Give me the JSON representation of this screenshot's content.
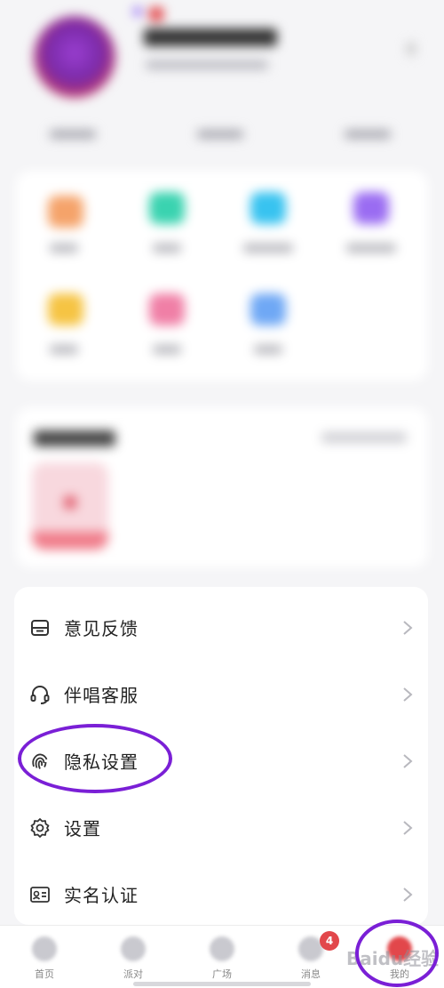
{
  "menu": {
    "items": [
      {
        "label": "意见反馈",
        "icon": "feedback-icon"
      },
      {
        "label": "伴唱客服",
        "icon": "headset-icon"
      },
      {
        "label": "隐私设置",
        "icon": "fingerprint-icon"
      },
      {
        "label": "设置",
        "icon": "gear-icon"
      },
      {
        "label": "实名认证",
        "icon": "id-card-icon"
      }
    ]
  },
  "tabbar": {
    "tabs": [
      {
        "label": "首页"
      },
      {
        "label": "派对"
      },
      {
        "label": "广场"
      },
      {
        "label": "消息",
        "badge": "4"
      },
      {
        "label": "我的"
      }
    ]
  },
  "watermark": "Baidu经验",
  "colors": {
    "annotation": "#7a1fd6",
    "badge": "#e2474b",
    "text": "#222222"
  }
}
